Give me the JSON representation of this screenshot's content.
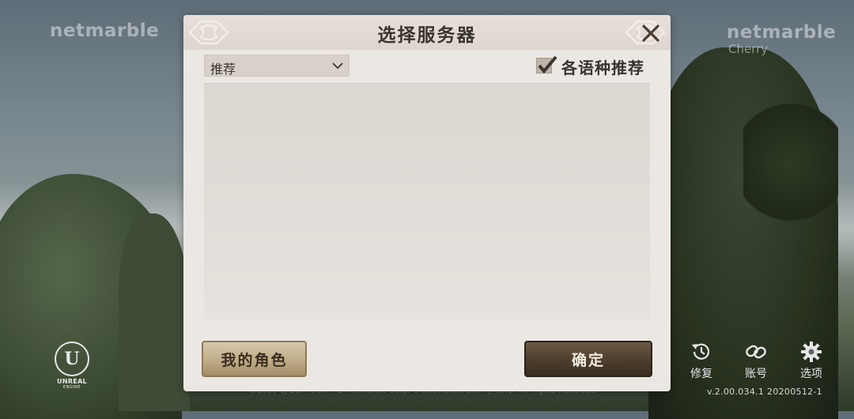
{
  "background": {
    "brand_left": "netmarble",
    "brand_right": "netmarble",
    "brand_right_sub": "Cherry",
    "engine_logo": {
      "icon": "unreal-engine-logo",
      "text": "UNREAL",
      "sub": "ENGINE"
    },
    "copyright": "©2020 CJ E&M CORP. & Netmarble Corp. & Netmarble Cherry Corp. All Rights Reserved.",
    "version": "v.2.00.034.1  20200512-1"
  },
  "utilities": [
    {
      "label": "修复",
      "icon": "repair-clock-icon"
    },
    {
      "label": "账号",
      "icon": "account-link-icon"
    },
    {
      "label": "选项",
      "icon": "gear-icon"
    }
  ],
  "dialog": {
    "title": "选择服务器",
    "close_icon": "close-icon",
    "filter": {
      "selected": "推荐",
      "icon": "chevron-down-icon"
    },
    "language_checkbox": {
      "label": "各语种推荐",
      "checked": true
    },
    "server_list": [],
    "buttons": {
      "my_characters": "我的角色",
      "confirm": "确定"
    }
  },
  "colors": {
    "dialog_bg": "#ebe8e3",
    "header_bg": "#ded5ce",
    "primary_button": "#4d3d2d",
    "secondary_button": "#c3af8c",
    "text_dark": "#3a3430"
  }
}
